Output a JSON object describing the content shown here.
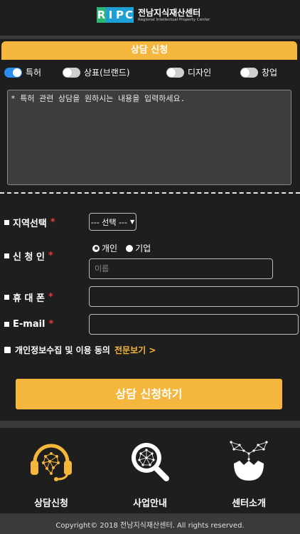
{
  "header": {
    "logo_letters": [
      "R",
      "I",
      "P",
      "C"
    ],
    "logo_colors": [
      "#2bb673",
      "#1e9fd6",
      "#1e9fd6",
      "#1e9fd6"
    ],
    "title": "전남지식재산센터",
    "subtitle": "Regional Intellectual Property Center"
  },
  "form": {
    "title": "상담 신청",
    "toggles": [
      {
        "label": "특허",
        "on": true
      },
      {
        "label": "상표(브랜드)",
        "on": false
      },
      {
        "label": "디자인",
        "on": false
      },
      {
        "label": "창업",
        "on": false
      }
    ],
    "textarea_placeholder": "* 특허 관련 상담을 원하시는 내용을 입력하세요.",
    "region_label": "지역선택",
    "region_select": "--- 선택 ---",
    "applicant_label": "신 청 인",
    "radio_personal": "개인",
    "radio_company": "기업",
    "radio_selected": "개인",
    "name_placeholder": "이름",
    "phone_label": "휴 대 폰",
    "email_label": "E-mail",
    "required_mark": "*",
    "privacy_text": "개인정보수집 및 이용 동의",
    "privacy_link": "전문보기 >",
    "submit_label": "상담 신청하기"
  },
  "nav": {
    "items": [
      {
        "label": "상담신청",
        "icon": "headset-icon"
      },
      {
        "label": "사업안내",
        "icon": "magnifier-icon"
      },
      {
        "label": "센터소개",
        "icon": "sprout-icon"
      }
    ]
  },
  "footer": {
    "copyright": "Copyright© 2018 전남지식재산센터. All rights reserved."
  },
  "colors": {
    "accent": "#f5b63d",
    "toggle_on": "#2d8cf0",
    "required": "#e83a3a"
  }
}
